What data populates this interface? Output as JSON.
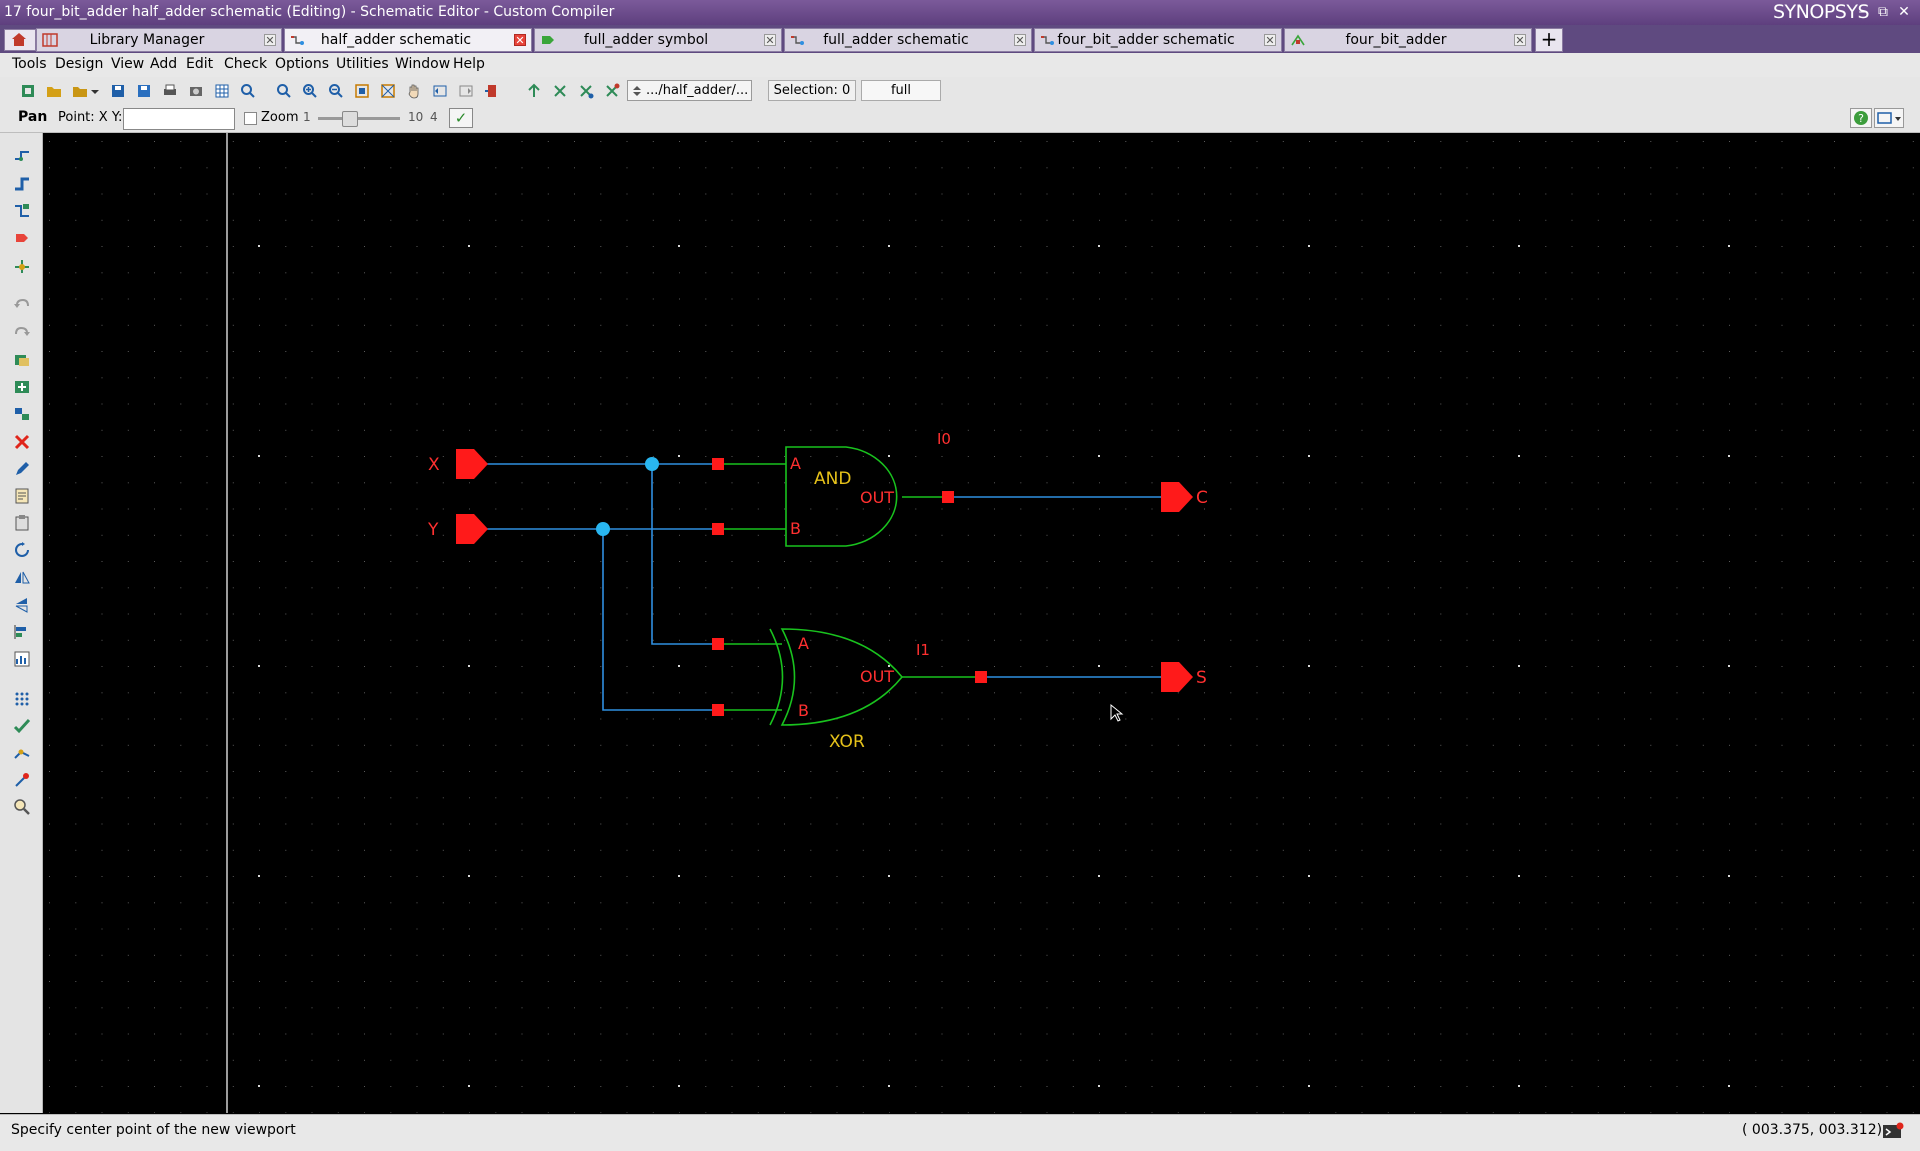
{
  "window": {
    "title": "17 four_bit_adder half_adder schematic (Editing) - Schematic Editor - Custom Compiler",
    "brand": "SYNOPSYS",
    "controls": [
      "–",
      "⧉",
      "✕"
    ]
  },
  "tabs": [
    {
      "label": "Library Manager",
      "icon": "library-manager-icon",
      "active": false
    },
    {
      "label": "half_adder schematic",
      "icon": "schematic-icon",
      "active": true
    },
    {
      "label": "full_adder symbol",
      "icon": "symbol-icon",
      "active": false
    },
    {
      "label": "full_adder schematic",
      "icon": "schematic-icon",
      "active": false
    },
    {
      "label": "four_bit_adder schematic",
      "icon": "schematic-icon",
      "active": false
    },
    {
      "label": "four_bit_adder",
      "icon": "layout-icon",
      "active": false
    }
  ],
  "menu": [
    "Tools",
    "Design",
    "View",
    "Add",
    "Edit",
    "Check",
    "Options",
    "Utilities",
    "Window",
    "Help"
  ],
  "toolbar": {
    "path": ".../half_adder/...",
    "selection": "Selection: 0",
    "mode": "full"
  },
  "options": {
    "mode": "Pan",
    "point_label": "Point: X Y:",
    "point_value": "",
    "zoom_label": "Zoom",
    "zoom_min": "1",
    "zoom_max": "10",
    "zoom_value": "4",
    "zoom_level": 0.35
  },
  "schematic": {
    "pins": {
      "x": "X",
      "y": "Y",
      "c": "C",
      "s": "S"
    },
    "and_gate": {
      "name": "AND",
      "inst": "I0",
      "pin_a": "A",
      "pin_b": "B",
      "pin_out": "OUT"
    },
    "xor_gate": {
      "name": "XOR",
      "inst": "I1",
      "pin_a": "A",
      "pin_b": "B",
      "pin_out": "OUT"
    },
    "colors": {
      "wire": "#2f8fe0",
      "gate": "#19c21e",
      "pin": "#ff1a1a",
      "label": "#e6c21a",
      "junction": "#29b6f0"
    }
  },
  "status": {
    "message": "Specify center point of the new viewport",
    "coords": "( 003.375,  003.312)"
  }
}
